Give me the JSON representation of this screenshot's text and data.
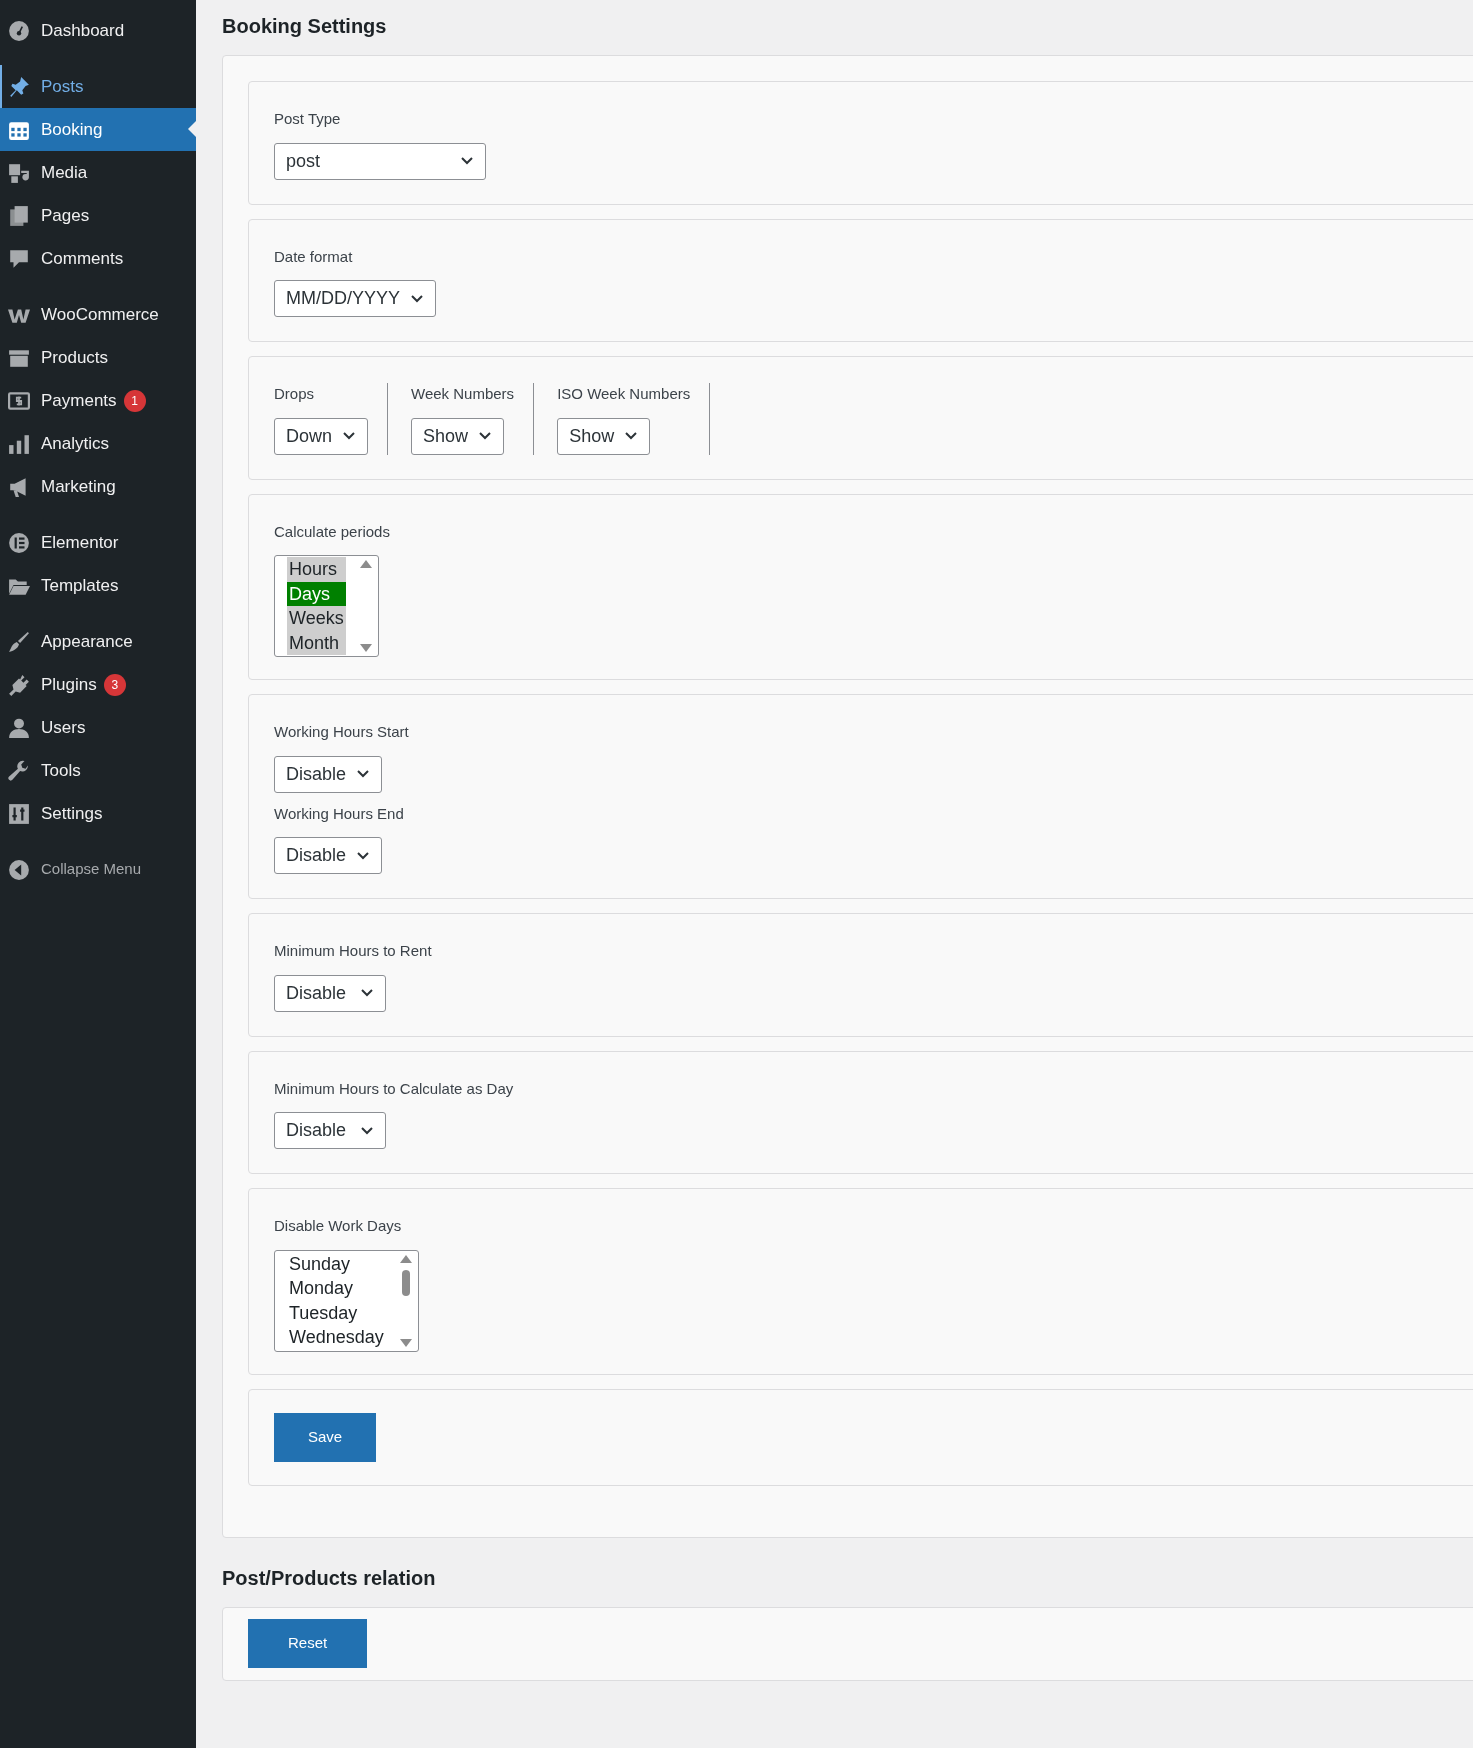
{
  "sidebar": {
    "groups": [
      [
        {
          "label": "Dashboard",
          "selected": false,
          "hovered": false
        }
      ],
      [
        {
          "label": "Posts",
          "selected": false,
          "hovered": true
        },
        {
          "label": "Booking",
          "selected": true,
          "hovered": false
        },
        {
          "label": "Media",
          "selected": false,
          "hovered": false
        },
        {
          "label": "Pages",
          "selected": false,
          "hovered": false
        },
        {
          "label": "Comments",
          "selected": false,
          "hovered": false
        }
      ],
      [
        {
          "label": "WooCommerce",
          "selected": false,
          "hovered": false
        },
        {
          "label": "Products",
          "selected": false,
          "hovered": false
        },
        {
          "label": "Payments",
          "selected": false,
          "hovered": false,
          "badge": "1"
        },
        {
          "label": "Analytics",
          "selected": false,
          "hovered": false
        },
        {
          "label": "Marketing",
          "selected": false,
          "hovered": false
        }
      ],
      [
        {
          "label": "Elementor",
          "selected": false,
          "hovered": false
        },
        {
          "label": "Templates",
          "selected": false,
          "hovered": false
        }
      ],
      [
        {
          "label": "Appearance",
          "selected": false,
          "hovered": false
        },
        {
          "label": "Plugins",
          "selected": false,
          "hovered": false,
          "badge": "3"
        },
        {
          "label": "Users",
          "selected": false,
          "hovered": false
        },
        {
          "label": "Tools",
          "selected": false,
          "hovered": false
        },
        {
          "label": "Settings",
          "selected": false,
          "hovered": false
        }
      ]
    ],
    "collapse_label": "Collapse Menu"
  },
  "booking_settings": {
    "title": "Booking Settings",
    "sections": [
      {
        "kind": "fields",
        "fields": [
          {
            "label": "Post Type",
            "value": "post"
          }
        ]
      },
      {
        "kind": "fields",
        "fields": [
          {
            "label": "Date format",
            "value": "MM/DD/YYYY"
          }
        ]
      },
      {
        "kind": "inline",
        "fields": [
          {
            "label": "Drops",
            "value": "Down"
          },
          {
            "label": "Week Numbers",
            "value": "Show"
          },
          {
            "label": "ISO Week Numbers",
            "value": "Show"
          }
        ]
      },
      {
        "kind": "listbox",
        "label": "Calculate periods",
        "scrollbar": false,
        "options": [
          {
            "label": "Hours",
            "selected": true,
            "focused": false
          },
          {
            "label": "Days",
            "selected": true,
            "focused": true
          },
          {
            "label": "Weeks",
            "selected": true,
            "focused": false
          },
          {
            "label": "Month",
            "selected": true,
            "focused": false
          }
        ]
      },
      {
        "kind": "fields",
        "fields": [
          {
            "label": "Working Hours Start",
            "value": "Disable"
          },
          {
            "label": "Working Hours End",
            "value": "Disable"
          }
        ]
      },
      {
        "kind": "fields",
        "fields": [
          {
            "label": "Minimum Hours to Rent",
            "value": "Disable"
          }
        ]
      },
      {
        "kind": "fields",
        "fields": [
          {
            "label": "Minimum Hours to Calculate as Day",
            "value": "Disable"
          }
        ]
      },
      {
        "kind": "listbox",
        "label": "Disable Work Days",
        "scrollbar": true,
        "options": [
          {
            "label": "Sunday",
            "selected": false,
            "focused": false
          },
          {
            "label": "Monday",
            "selected": false,
            "focused": false
          },
          {
            "label": "Tuesday",
            "selected": false,
            "focused": false
          },
          {
            "label": "Wednesday",
            "selected": false,
            "focused": false
          }
        ]
      },
      {
        "kind": "button",
        "label": "Save"
      }
    ]
  },
  "relation": {
    "title": "Post/Products relation",
    "button": "Reset"
  }
}
